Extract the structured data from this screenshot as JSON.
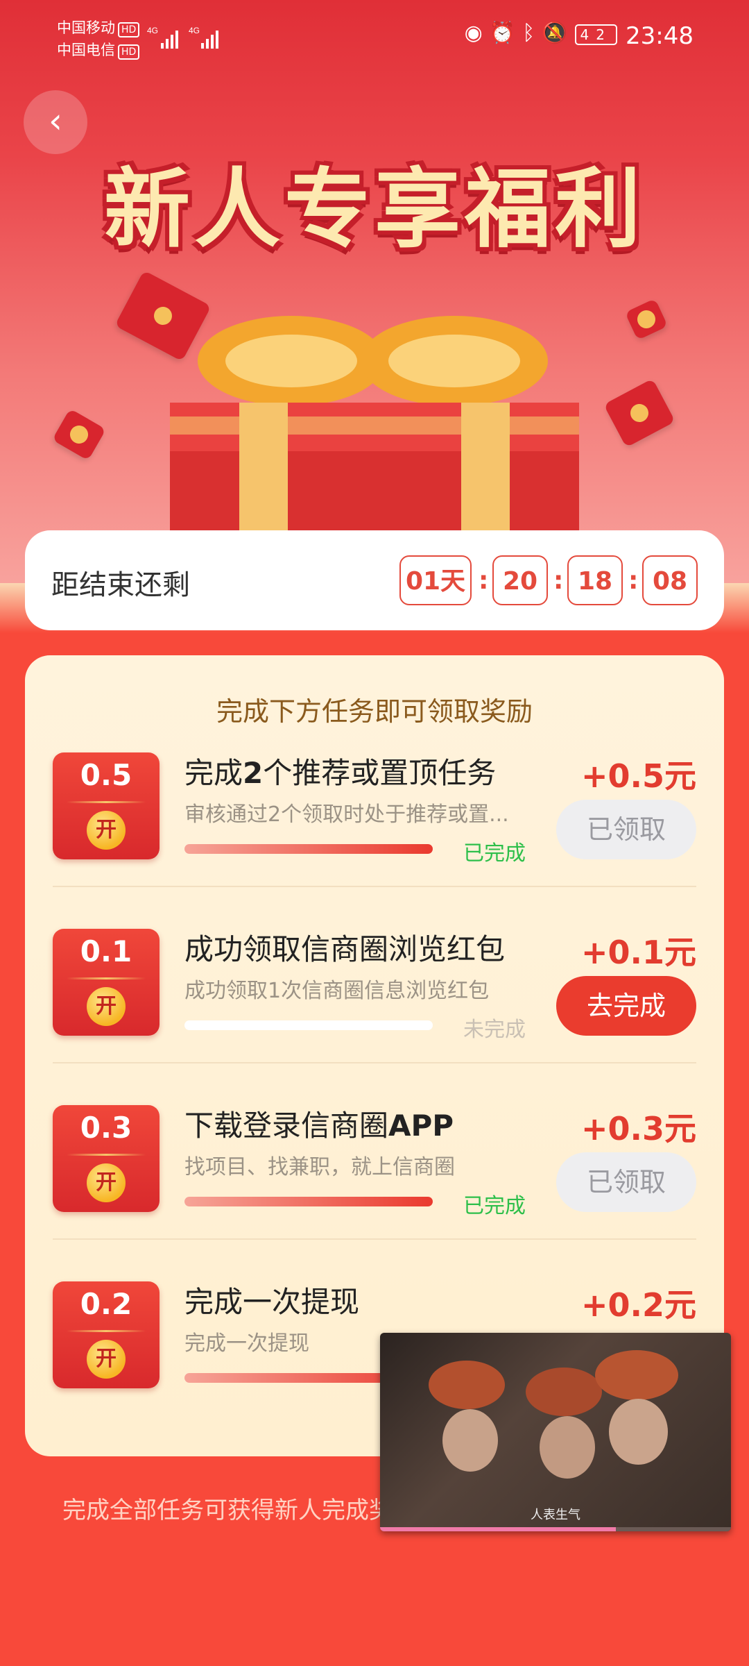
{
  "status_bar": {
    "carrier1": "中国移动",
    "carrier2": "中国电信",
    "hd": "HD",
    "network": "4G",
    "battery": "42",
    "time": "23:48"
  },
  "banner": {
    "title": "新人专享福利",
    "accent_color": "#e02f37"
  },
  "countdown": {
    "label": "距结束还剩",
    "days": "01天",
    "hours": "20",
    "minutes": "18",
    "seconds": "08",
    "separator": ":"
  },
  "tasks_section": {
    "heading": "完成下方任务即可领取奖励",
    "tasks": [
      {
        "coin_value": "0.5",
        "coin_label": "开",
        "title_pre": "完成",
        "title_bold": "2",
        "title_post": "个推荐或置顶任务",
        "description": "审核通过2个领取时处于推荐或置...",
        "progress": 1.0,
        "status": "已完成",
        "reward": "+0.5元",
        "button": "已领取"
      },
      {
        "coin_value": "0.1",
        "coin_label": "开",
        "title_pre": "成功领取信商圈浏览红包",
        "title_bold": "",
        "title_post": "",
        "description": "成功领取1次信商圈信息浏览红包",
        "progress": 0.0,
        "status": "未完成",
        "reward": "+0.1元",
        "button": "去完成"
      },
      {
        "coin_value": "0.3",
        "coin_label": "开",
        "title_pre": "下载登录信商圈",
        "title_bold": "APP",
        "title_post": "",
        "description": "找项目、找兼职，就上信商圈",
        "progress": 1.0,
        "status": "已完成",
        "reward": "+0.3元",
        "button": "已领取"
      },
      {
        "coin_value": "0.2",
        "coin_label": "开",
        "title_pre": "完成一次提现",
        "title_bold": "",
        "title_post": "",
        "description": "完成一次提现",
        "progress": 1.0,
        "reward": "+0.2元"
      }
    ]
  },
  "footer": {
    "note": "完成全部任务可获得新人完成奖"
  },
  "video_overlay": {
    "subtitle": "人表生气"
  }
}
